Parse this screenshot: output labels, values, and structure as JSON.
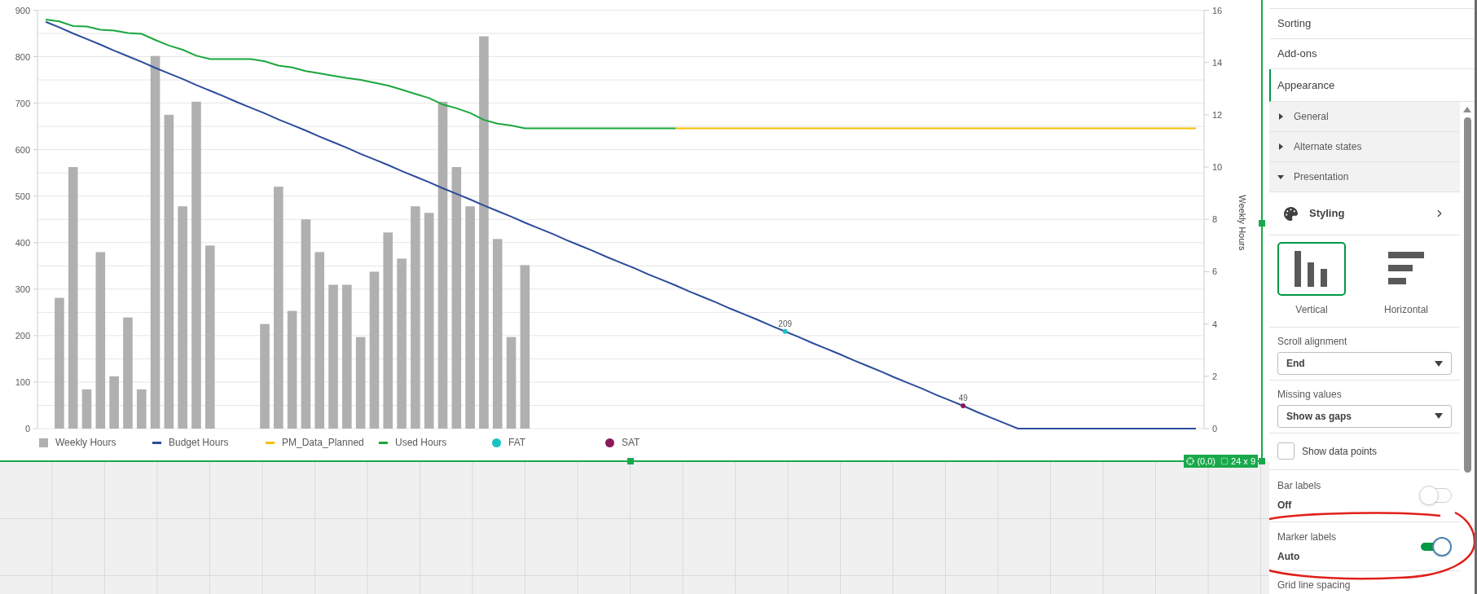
{
  "chart": {
    "chart_data": {
      "type": "bar",
      "y2label": "Weekly Hours",
      "ylim": [
        0,
        900
      ],
      "yticks": [
        0,
        100,
        200,
        300,
        400,
        500,
        600,
        700,
        800,
        900
      ],
      "y2lim": [
        0,
        16
      ],
      "y2ticks": [
        0,
        2,
        4,
        6,
        8,
        10,
        12,
        14,
        16
      ],
      "grid": true,
      "legend": "bottom",
      "series": [
        {
          "name": "Weekly Hours",
          "type": "bar",
          "axis": "y2",
          "color": "#b0b0b0",
          "values": [
            null,
            5,
            10,
            1.5,
            6.75,
            2,
            4.25,
            1.5,
            14.25,
            12,
            8.5,
            12.5,
            7,
            null,
            null,
            null,
            4,
            9.25,
            4.5,
            8,
            6.75,
            5.5,
            5.5,
            3.5,
            6,
            7.5,
            6.5,
            8.5,
            8.25,
            12.5,
            10,
            8.5,
            15,
            7.25,
            3.5,
            6.25,
            null,
            null,
            null,
            null,
            null,
            null,
            null,
            null,
            null,
            null,
            null,
            null,
            null,
            null,
            null,
            null,
            null,
            null,
            null,
            null,
            null,
            null,
            null,
            null,
            null,
            null,
            null,
            null,
            null,
            null,
            null,
            null,
            null,
            null,
            null,
            null,
            null,
            null,
            null,
            null,
            null,
            null,
            null,
            null,
            null,
            null,
            null,
            null,
            null
          ]
        },
        {
          "name": "Budget Hours",
          "type": "line",
          "color": "#2b4c9b",
          "values": [
            875,
            863,
            850,
            838,
            826,
            813,
            801,
            789,
            776,
            764,
            752,
            739,
            727,
            715,
            702,
            690,
            678,
            665,
            653,
            641,
            628,
            616,
            604,
            591,
            579,
            567,
            554,
            542,
            530,
            517,
            505,
            493,
            480,
            468,
            456,
            443,
            431,
            419,
            406,
            394,
            382,
            369,
            357,
            345,
            332,
            320,
            308,
            295,
            283,
            271,
            258,
            246,
            234,
            221,
            209,
            197,
            184,
            172,
            160,
            147,
            135,
            123,
            110,
            98,
            86,
            73,
            61,
            49,
            36,
            24,
            12,
            0,
            0,
            0,
            0,
            0,
            0,
            0,
            0,
            0,
            0,
            0,
            0,
            0,
            0
          ]
        },
        {
          "name": "PM_Data_Planned",
          "type": "line",
          "color": "#f5bf00",
          "values": [
            null,
            null,
            null,
            null,
            null,
            null,
            null,
            null,
            null,
            null,
            null,
            null,
            null,
            null,
            null,
            null,
            null,
            null,
            null,
            null,
            null,
            null,
            null,
            null,
            null,
            null,
            null,
            null,
            null,
            null,
            null,
            null,
            null,
            null,
            null,
            null,
            null,
            null,
            null,
            null,
            null,
            null,
            null,
            null,
            null,
            null,
            646,
            646,
            646,
            646,
            646,
            646,
            646,
            646,
            646,
            646,
            646,
            646,
            646,
            646,
            646,
            646,
            646,
            646,
            646,
            646,
            646,
            646,
            646,
            646,
            646,
            646,
            646,
            646,
            646,
            646,
            646,
            646,
            646,
            646,
            646,
            646,
            646,
            646,
            646
          ]
        },
        {
          "name": "Used Hours",
          "type": "line",
          "color": "#1aa73d",
          "values": [
            880,
            876,
            866,
            865,
            858,
            856,
            851,
            849,
            836,
            824,
            815,
            802,
            795,
            795,
            795,
            795,
            790,
            781,
            777,
            769,
            764,
            759,
            754,
            750,
            744,
            738,
            729,
            720,
            711,
            697,
            689,
            679,
            664,
            656,
            652,
            646,
            646,
            646,
            646,
            646,
            646,
            646,
            646,
            646,
            646,
            646,
            646,
            null,
            null,
            null,
            null,
            null,
            null,
            null,
            null,
            null,
            null,
            null,
            null,
            null,
            null,
            null,
            null,
            null,
            null,
            null,
            null,
            null,
            null,
            null,
            null,
            null,
            null,
            null,
            null,
            null,
            null,
            null,
            null,
            null,
            null,
            null,
            null,
            null,
            null
          ]
        },
        {
          "name": "FAT",
          "type": "scatter",
          "color": "#17c3c3",
          "values": [
            null,
            null,
            null,
            null,
            null,
            null,
            null,
            null,
            null,
            null,
            null,
            null,
            null,
            null,
            null,
            null,
            null,
            null,
            null,
            null,
            null,
            null,
            null,
            null,
            null,
            null,
            null,
            null,
            null,
            null,
            null,
            null,
            null,
            null,
            null,
            null,
            null,
            null,
            null,
            null,
            null,
            null,
            null,
            null,
            null,
            null,
            null,
            null,
            null,
            null,
            null,
            null,
            null,
            null,
            209,
            null,
            null,
            null,
            null,
            null,
            null,
            null,
            null,
            null,
            null,
            null,
            null,
            null,
            null,
            null,
            null,
            null,
            null,
            null,
            null,
            null,
            null,
            null,
            null,
            null,
            null,
            null,
            null,
            null,
            null
          ],
          "value_labels": [
            null,
            null,
            null,
            null,
            null,
            null,
            null,
            null,
            null,
            null,
            null,
            null,
            null,
            null,
            null,
            null,
            null,
            null,
            null,
            null,
            null,
            null,
            null,
            null,
            null,
            null,
            null,
            null,
            null,
            null,
            null,
            null,
            null,
            null,
            null,
            null,
            null,
            null,
            null,
            null,
            null,
            null,
            null,
            null,
            null,
            null,
            null,
            null,
            null,
            null,
            null,
            null,
            null,
            null,
            "209",
            null,
            null,
            null,
            null,
            null,
            null,
            null,
            null,
            null,
            null,
            null,
            null,
            null,
            null,
            null,
            null,
            null,
            null,
            null,
            null,
            null,
            null,
            null,
            null,
            null,
            null,
            null,
            null,
            null,
            null
          ]
        },
        {
          "name": "SAT",
          "type": "scatter",
          "color": "#8b1a5b",
          "values": [
            null,
            null,
            null,
            null,
            null,
            null,
            null,
            null,
            null,
            null,
            null,
            null,
            null,
            null,
            null,
            null,
            null,
            null,
            null,
            null,
            null,
            null,
            null,
            null,
            null,
            null,
            null,
            null,
            null,
            null,
            null,
            null,
            null,
            null,
            null,
            null,
            null,
            null,
            null,
            null,
            null,
            null,
            null,
            null,
            null,
            null,
            null,
            null,
            null,
            null,
            null,
            null,
            null,
            null,
            null,
            null,
            null,
            null,
            null,
            null,
            null,
            null,
            null,
            null,
            null,
            null,
            null,
            49,
            null,
            null,
            null,
            null,
            null,
            null,
            null,
            null,
            null,
            null,
            null,
            null,
            null,
            null,
            null,
            null,
            null
          ],
          "value_labels": [
            null,
            null,
            null,
            null,
            null,
            null,
            null,
            null,
            null,
            null,
            null,
            null,
            null,
            null,
            null,
            null,
            null,
            null,
            null,
            null,
            null,
            null,
            null,
            null,
            null,
            null,
            null,
            null,
            null,
            null,
            null,
            null,
            null,
            null,
            null,
            null,
            null,
            null,
            null,
            null,
            null,
            null,
            null,
            null,
            null,
            null,
            null,
            null,
            null,
            null,
            null,
            null,
            null,
            null,
            null,
            null,
            null,
            null,
            null,
            null,
            null,
            null,
            null,
            null,
            null,
            null,
            null,
            "49",
            null,
            null,
            null,
            null,
            null,
            null,
            null,
            null,
            null,
            null,
            null,
            null,
            null,
            null,
            null,
            null,
            null
          ]
        }
      ]
    },
    "selection_badge": {
      "position": "(0,0)",
      "size": "24 x 9"
    }
  },
  "panel": {
    "top_tabs": [
      {
        "label": "Sorting",
        "selected": false
      },
      {
        "label": "Add-ons",
        "selected": false
      },
      {
        "label": "Appearance",
        "selected": true
      }
    ],
    "sections": [
      {
        "label": "General",
        "expanded": false
      },
      {
        "label": "Alternate states",
        "expanded": false
      },
      {
        "label": "Presentation",
        "expanded": true
      }
    ],
    "styling": {
      "label": "Styling"
    },
    "orientation_options": [
      {
        "kind": "vertical",
        "label": "Vertical",
        "selected": true
      },
      {
        "kind": "horizontal",
        "label": "Horizontal",
        "selected": false
      }
    ],
    "fields": [
      {
        "kind": "select",
        "label": "Scroll alignment",
        "value": "End"
      },
      {
        "kind": "select",
        "label": "Missing values",
        "value": "Show as gaps"
      },
      {
        "kind": "checkbox",
        "label": "Show data points",
        "checked": false
      },
      {
        "kind": "switch",
        "label": "Bar labels",
        "value": "Off",
        "on": false,
        "highlighted": false
      },
      {
        "kind": "switch",
        "label": "Marker labels",
        "value": "Auto",
        "on": true,
        "highlighted": true
      },
      {
        "kind": "heading",
        "label": "Grid line spacing"
      }
    ]
  }
}
